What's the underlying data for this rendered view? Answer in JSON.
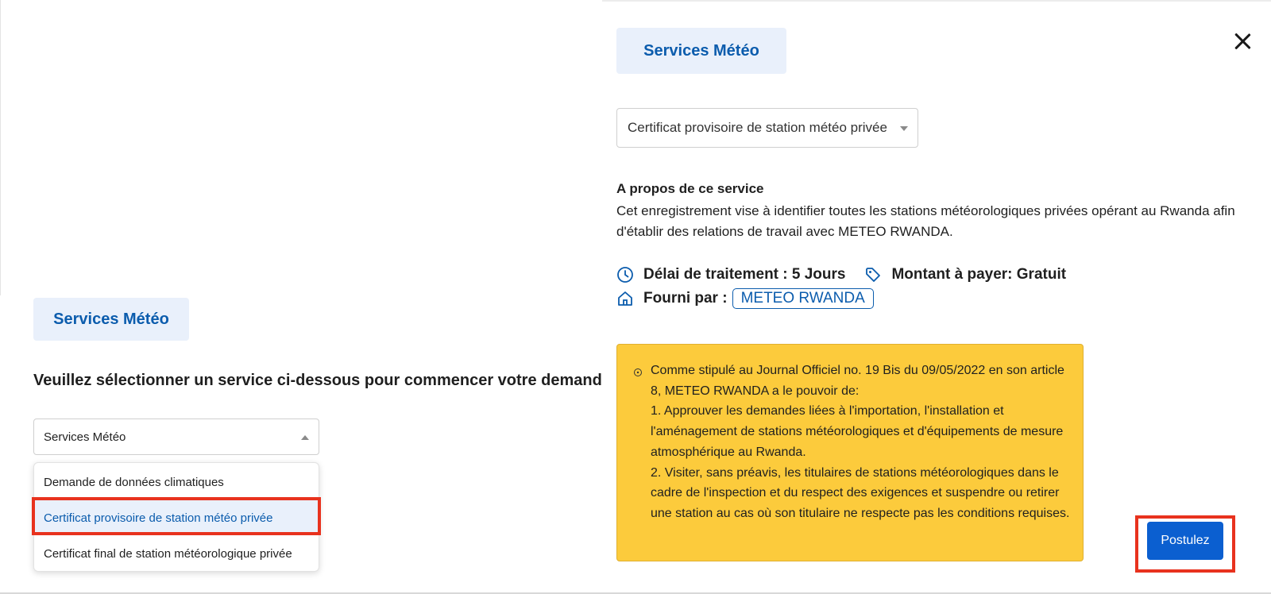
{
  "left": {
    "chip_label": "Services Météo",
    "prompt": "Veuillez sélectionner un service ci-dessous pour commencer votre demande",
    "select_value": "Services Météo",
    "options": [
      "Demande de données climatiques",
      "Certificat provisoire de station météo privée",
      "Certificat final de station météorologique privée"
    ],
    "highlighted_option_index": 1
  },
  "drawer": {
    "chip_label": "Services Météo",
    "close_icon": "close-icon",
    "select_value": "Certificat provisoire de station météo privée",
    "about_title": "A propos de ce service",
    "about_text": "Cet enregistrement vise à identifier toutes les stations météorologiques privées opérant au Rwanda afin d'établir des relations de travail avec METEO RWANDA.",
    "processing_time": "Délai de traitement : 5 Jours",
    "amount": "Montant à payer: Gratuit",
    "provided_by_label": "Fourni par :",
    "provider": "METEO RWANDA",
    "notice": {
      "icon": "info-circle-icon",
      "lines": [
        "Comme stipulé au Journal Officiel no. 19 Bis du 09/05/2022 en son article 8, METEO RWANDA a le pouvoir de:",
        "1. Approuver les demandes liées à l'importation, l'installation et l'aménagement de stations météorologiques et d'équipements de mesure atmosphérique au Rwanda.",
        "2. Visiter, sans préavis, les titulaires de stations météorologiques dans le cadre de l'inspection et du respect des exigences et suspendre ou retirer une station au cas où son titulaire ne respecte pas les conditions requises."
      ]
    },
    "apply_label": "Postulez"
  },
  "colors": {
    "accent": "#0b5cad",
    "chip_bg": "#e9f0fb",
    "notice_bg": "#fccb3c",
    "button_bg": "#0b5fd0",
    "highlight": "#e8321e"
  }
}
